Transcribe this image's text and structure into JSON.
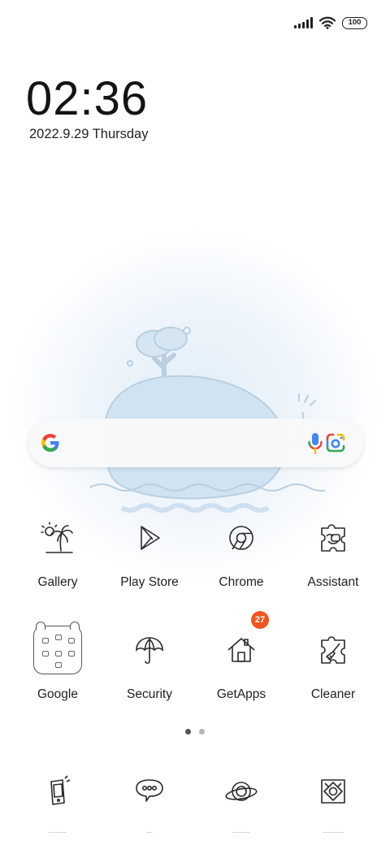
{
  "status_bar": {
    "signal_icon": "cellular-signal-icon",
    "wifi_icon": "wifi-icon",
    "battery_level": "100"
  },
  "clock": {
    "time": "02:36",
    "date": "2022.9.29 Thursday"
  },
  "search_bar": {
    "logo_icon": "google-g-icon",
    "mic_icon": "microphone-icon",
    "lens_icon": "google-lens-icon"
  },
  "apps": [
    {
      "label": "Gallery",
      "icon": "palm-tree-sun-icon"
    },
    {
      "label": "Play Store",
      "icon": "play-triangle-icon"
    },
    {
      "label": "Chrome",
      "icon": "chrome-icon"
    },
    {
      "label": "Assistant",
      "icon": "puzzle-assistant-icon"
    },
    {
      "label": "Google",
      "icon": "folder-icon"
    },
    {
      "label": "Security",
      "icon": "umbrella-icon"
    },
    {
      "label": "GetApps",
      "icon": "house-icon",
      "badge": "27"
    },
    {
      "label": "Cleaner",
      "icon": "puzzle-broom-icon"
    }
  ],
  "page_indicator": {
    "pages": 2,
    "current": 1
  },
  "dock": [
    {
      "icon": "phone-icon"
    },
    {
      "icon": "message-bubble-icon"
    },
    {
      "icon": "planet-browser-icon"
    },
    {
      "icon": "camera-frame-icon"
    }
  ],
  "colors": {
    "badge": "#f0551e",
    "wallpaper_blue": "#e2eef8"
  }
}
